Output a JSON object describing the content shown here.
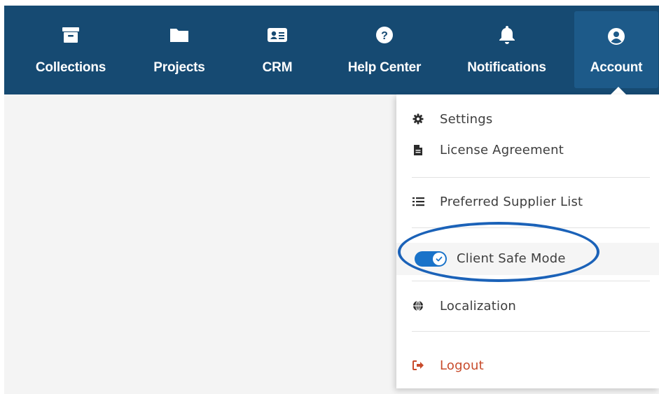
{
  "navbar": {
    "items": [
      {
        "label": "Collections",
        "icon": "archive-box-icon"
      },
      {
        "label": "Projects",
        "icon": "folder-icon"
      },
      {
        "label": "CRM",
        "icon": "contact-card-icon"
      },
      {
        "label": "Help Center",
        "icon": "question-circle-icon"
      },
      {
        "label": "Notifications",
        "icon": "bell-icon"
      },
      {
        "label": "Account",
        "icon": "user-circle-icon",
        "active": true
      }
    ]
  },
  "account_menu": {
    "settings": "Settings",
    "license_agreement": "License Agreement",
    "preferred_supplier_list": "Preferred Supplier List",
    "client_safe_mode": {
      "label": "Client Safe Mode",
      "enabled": true
    },
    "localization": "Localization",
    "logout": "Logout"
  },
  "colors": {
    "navbar": "#164a72",
    "toggle_on": "#1a73c9",
    "logout": "#c84b2b",
    "highlight_ring": "#1b62b8"
  }
}
